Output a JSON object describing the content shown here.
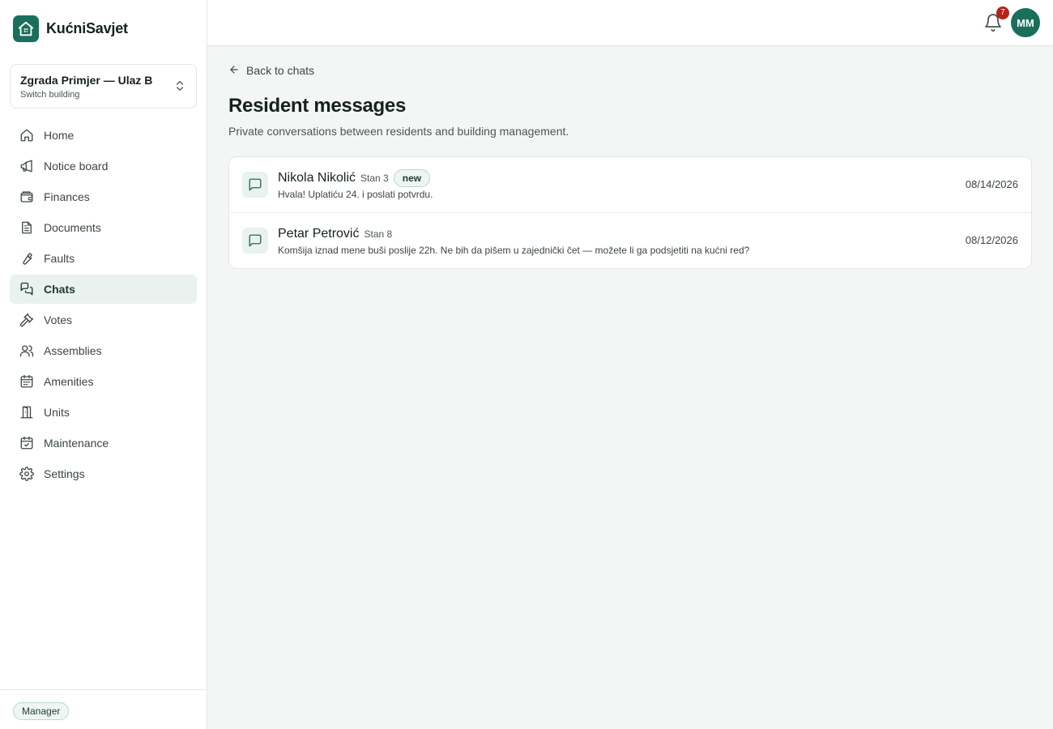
{
  "app": {
    "name": "KućniSavjet",
    "accent": "#1a6f5c"
  },
  "building": {
    "name": "Zgrada Primjer — Ulaz B",
    "switch_label": "Switch building"
  },
  "nav": [
    {
      "label": "Home",
      "icon": "home-icon"
    },
    {
      "label": "Notice board",
      "icon": "megaphone-icon"
    },
    {
      "label": "Finances",
      "icon": "wallet-icon"
    },
    {
      "label": "Documents",
      "icon": "document-icon"
    },
    {
      "label": "Faults",
      "icon": "wrench-icon"
    },
    {
      "label": "Chats",
      "icon": "chat-icon",
      "active": true
    },
    {
      "label": "Votes",
      "icon": "gavel-icon"
    },
    {
      "label": "Assemblies",
      "icon": "users-icon"
    },
    {
      "label": "Amenities",
      "icon": "calendar-icon"
    },
    {
      "label": "Units",
      "icon": "door-icon"
    },
    {
      "label": "Maintenance",
      "icon": "calendar-check-icon"
    },
    {
      "label": "Settings",
      "icon": "gear-icon"
    }
  ],
  "role": "Manager",
  "header": {
    "notifications_count": "7",
    "user_initials": "MM"
  },
  "page": {
    "back_label": "Back to chats",
    "title": "Resident messages",
    "subtitle": "Private conversations between residents and building management."
  },
  "conversations": [
    {
      "name": "Nikola Nikolić",
      "unit": "Stan 3",
      "badge": "new",
      "message": "Hvala! Uplatiću 24. i poslati potvrdu.",
      "date": "08/14/2026"
    },
    {
      "name": "Petar Petrović",
      "unit": "Stan 8",
      "badge": "",
      "message": "Komšija iznad mene buši poslije 22h. Ne bih da pišem u zajednički čet — možete li ga podsjetiti na kućni red?",
      "date": "08/12/2026"
    }
  ]
}
